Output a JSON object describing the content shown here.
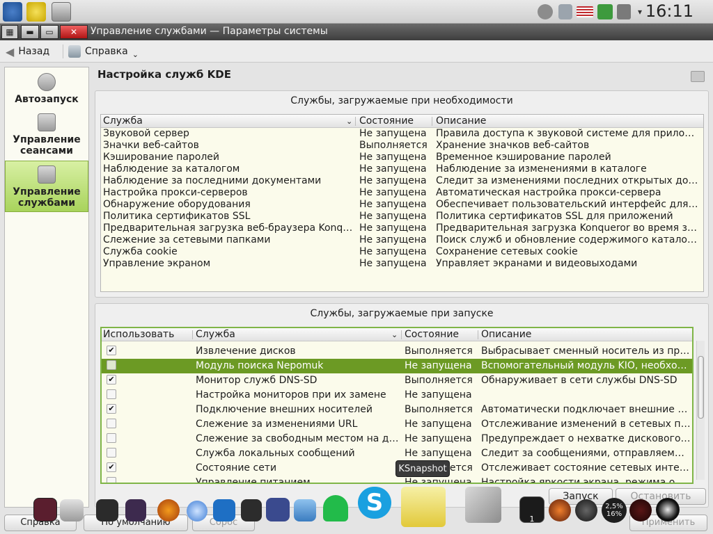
{
  "top_panel": {
    "clock": "16:11",
    "icons": [
      "kde-menu-icon",
      "radiation-icon",
      "system-settings-icon",
      "gear-icon",
      "clipboard-icon",
      "us-flag-icon",
      "volume-icon",
      "network-icon",
      "chevron-down-icon"
    ]
  },
  "window": {
    "title": "Управление службами — Параметры системы"
  },
  "toolbar": {
    "back_label": "Назад",
    "help_label": "Справка"
  },
  "sidebar": {
    "items": [
      {
        "label": "Автозапуск",
        "icon": "gear-icon"
      },
      {
        "label": "Управление сеансами",
        "icon": "session-icon"
      },
      {
        "label": "Управление службами",
        "icon": "services-icon"
      }
    ]
  },
  "page": {
    "title": "Настройка служб KDE"
  },
  "on_demand": {
    "title": "Службы, загружаемые при необходимости",
    "headers": {
      "service": "Служба",
      "status": "Состояние",
      "description": "Описание"
    },
    "rows": [
      {
        "service": "Звуковой сервер",
        "status": "Не запущена",
        "description": "Правила доступа к звуковой системе для приложений"
      },
      {
        "service": "Значки веб-сайтов",
        "status": "Выполняется",
        "description": "Хранение значков веб-сайтов"
      },
      {
        "service": "Кэширование паролей",
        "status": "Не запущена",
        "description": "Временное кэширование паролей"
      },
      {
        "service": "Наблюдение за каталогом",
        "status": "Не запущена",
        "description": "Наблюдение за изменениями в каталоге"
      },
      {
        "service": "Наблюдение за последними документами",
        "status": "Не запущена",
        "description": "Следит за изменениями последних открытых докум…"
      },
      {
        "service": "Настройка прокси-серверов",
        "status": "Не запущена",
        "description": "Автоматическая настройка прокси-сервера"
      },
      {
        "service": "Обнаружение оборудования",
        "status": "Не запущена",
        "description": "Обеспечивает пользовательский интерфейс для со…"
      },
      {
        "service": "Политика сертификатов SSL",
        "status": "Не запущена",
        "description": "Политика сертификатов SSL для приложений"
      },
      {
        "service": "Предварительная загрузка веб-браузера Konqueror",
        "status": "Не запущена",
        "description": "Предварительная загрузка Konqueror во время запу…"
      },
      {
        "service": "Слежение за сетевыми папками",
        "status": "Не запущена",
        "description": "Поиск служб и обновление содержимого каталогов …"
      },
      {
        "service": "Служба cookie",
        "status": "Не запущена",
        "description": "Сохранение сетевых cookie"
      },
      {
        "service": "Управление экраном",
        "status": "Не запущена",
        "description": "Управляет экранами и видеовыходами"
      }
    ]
  },
  "startup": {
    "title": "Службы, загружаемые при запуске",
    "headers": {
      "use": "Использовать",
      "service": "Служба",
      "status": "Состояние",
      "description": "Описание"
    },
    "rows": [
      {
        "checked": true,
        "service": "Извлечение дисков",
        "status": "Выполняется",
        "description": "Выбрасывает сменный носитель из прив…"
      },
      {
        "checked": false,
        "selected": true,
        "service": "Модуль поиска Nepomuk",
        "status": "Не запущена",
        "description": "Вспомогательный модуль KIO, необходи…"
      },
      {
        "checked": true,
        "service": "Монитор служб DNS-SD",
        "status": "Выполняется",
        "description": "Обнаруживает в сети службы DNS-SD"
      },
      {
        "checked": false,
        "service": "Настройка мониторов при их замене",
        "status": "Не запущена",
        "description": ""
      },
      {
        "checked": true,
        "service": "Подключение внешних носителей",
        "status": "Выполняется",
        "description": "Автоматически подключает внешние нос…"
      },
      {
        "checked": false,
        "service": "Слежение за изменениями URL",
        "status": "Не запущена",
        "description": "Отслеживание изменений в сетевых пап…"
      },
      {
        "checked": false,
        "service": "Слежение за свободным местом на диске",
        "status": "Не запущена",
        "description": "Предупреждает о нехватке дискового пр…"
      },
      {
        "checked": false,
        "service": "Служба локальных сообщений",
        "status": "Не запущена",
        "description": "Следит за сообщениями, отправляемым…"
      },
      {
        "checked": true,
        "service": "Состояние сети",
        "status": "Выполняется",
        "description": "Отслеживает состояние сетевых интерф…"
      },
      {
        "checked": false,
        "service": "Управление питанием",
        "status": "Не запущена",
        "description": "Настройка яркости экрана, режима ожид…"
      }
    ],
    "start_label": "Запуск",
    "stop_label": "Остановить"
  },
  "bottom": {
    "help_label": "Справка",
    "defaults_label": "По умолчанию",
    "apply_label": "Применить",
    "reset_label": "Сброс"
  },
  "tooltip": "KSnapshot",
  "dock": {
    "pager_label": "1",
    "cpu_label_top": "2,5%",
    "cpu_label_bottom": "16%"
  }
}
